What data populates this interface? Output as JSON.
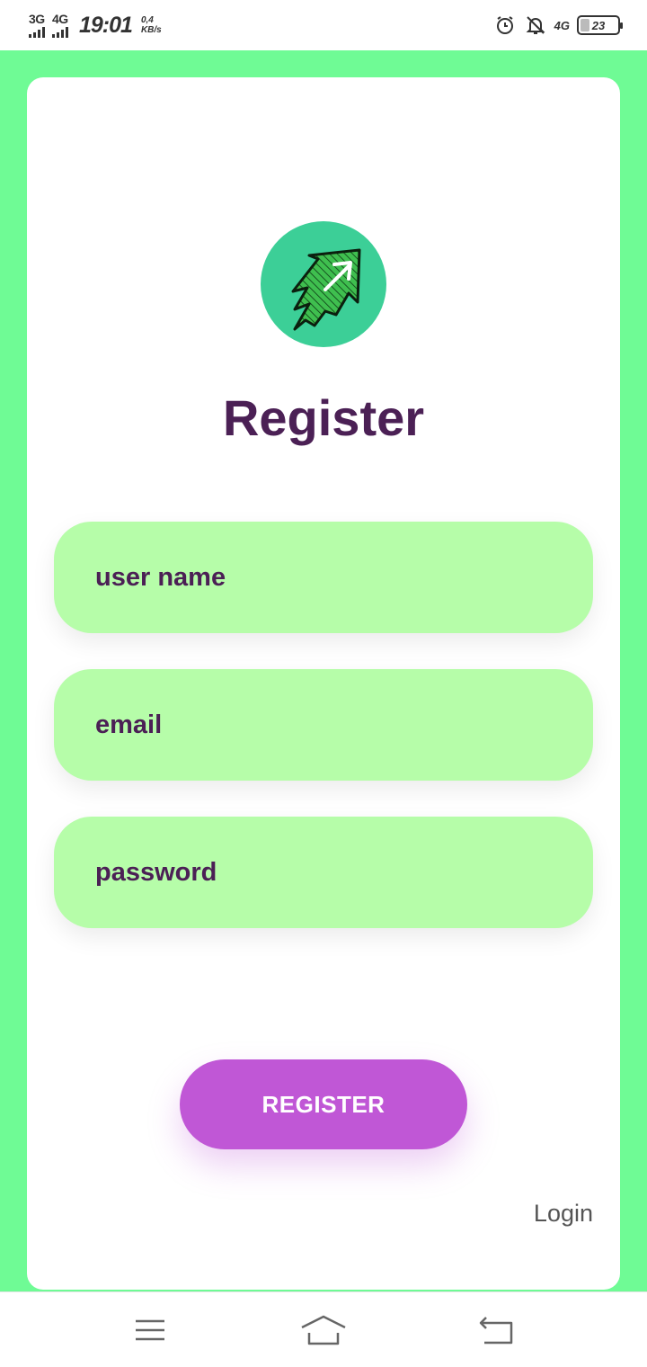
{
  "status_bar": {
    "network1": "3G",
    "network2": "4G",
    "time": "19:01",
    "speed_value": "0,4",
    "speed_unit": "KB/s",
    "network3": "4G",
    "battery": "23"
  },
  "logo": {
    "icon": "rocket-arrow-logo-icon"
  },
  "form": {
    "title": "Register",
    "username_placeholder": "user name",
    "email_placeholder": "email",
    "password_placeholder": "password",
    "submit_label": "REGISTER",
    "login_link": "Login"
  },
  "nav": {
    "menu_icon": "menu-icon",
    "home_icon": "home-icon",
    "back_icon": "back-icon"
  },
  "colors": {
    "background": "#6ffb95",
    "input_fill": "#b6fda9",
    "text_primary": "#4b2055",
    "button": "#c057d6",
    "logo_circle": "#3ccf97"
  }
}
